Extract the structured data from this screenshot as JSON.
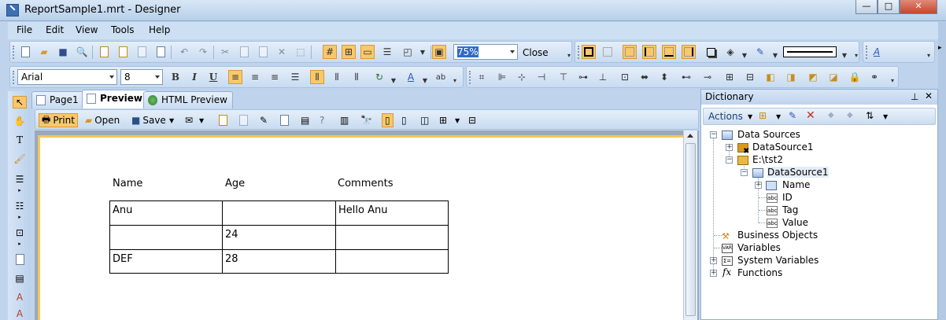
{
  "window": {
    "title": "ReportSample1.mrt - Designer",
    "min": "—",
    "max": "□",
    "close": "✕"
  },
  "menu": [
    "File",
    "Edit",
    "View",
    "Tools",
    "Help"
  ],
  "toolbar1": {
    "zoom": "75%",
    "close_label": "Close"
  },
  "toolbar2": {
    "font": "Arial",
    "size": "8",
    "bold": "B",
    "italic": "I",
    "underline": "U"
  },
  "tabs": [
    "Page1",
    "Preview",
    "HTML Preview"
  ],
  "preview_toolbar": {
    "print": "Print",
    "open": "Open",
    "save": "Save"
  },
  "report": {
    "headers": [
      "Name",
      "Age",
      "Comments"
    ],
    "rows": [
      [
        "Anu",
        "",
        "Hello Anu"
      ],
      [
        "",
        "24",
        ""
      ],
      [
        "DEF",
        "28",
        ""
      ]
    ]
  },
  "dictionary": {
    "title": "Dictionary",
    "actions": "Actions",
    "tree": {
      "data_sources": "Data Sources",
      "ds1": "DataSource1",
      "connection": "E:\\tst2",
      "ds1b": "DataSource1",
      "fields": [
        "Name",
        "ID",
        "Tag",
        "Value"
      ],
      "business_objects": "Business Objects",
      "variables": "Variables",
      "system_variables": "System Variables",
      "functions": "Functions"
    }
  }
}
